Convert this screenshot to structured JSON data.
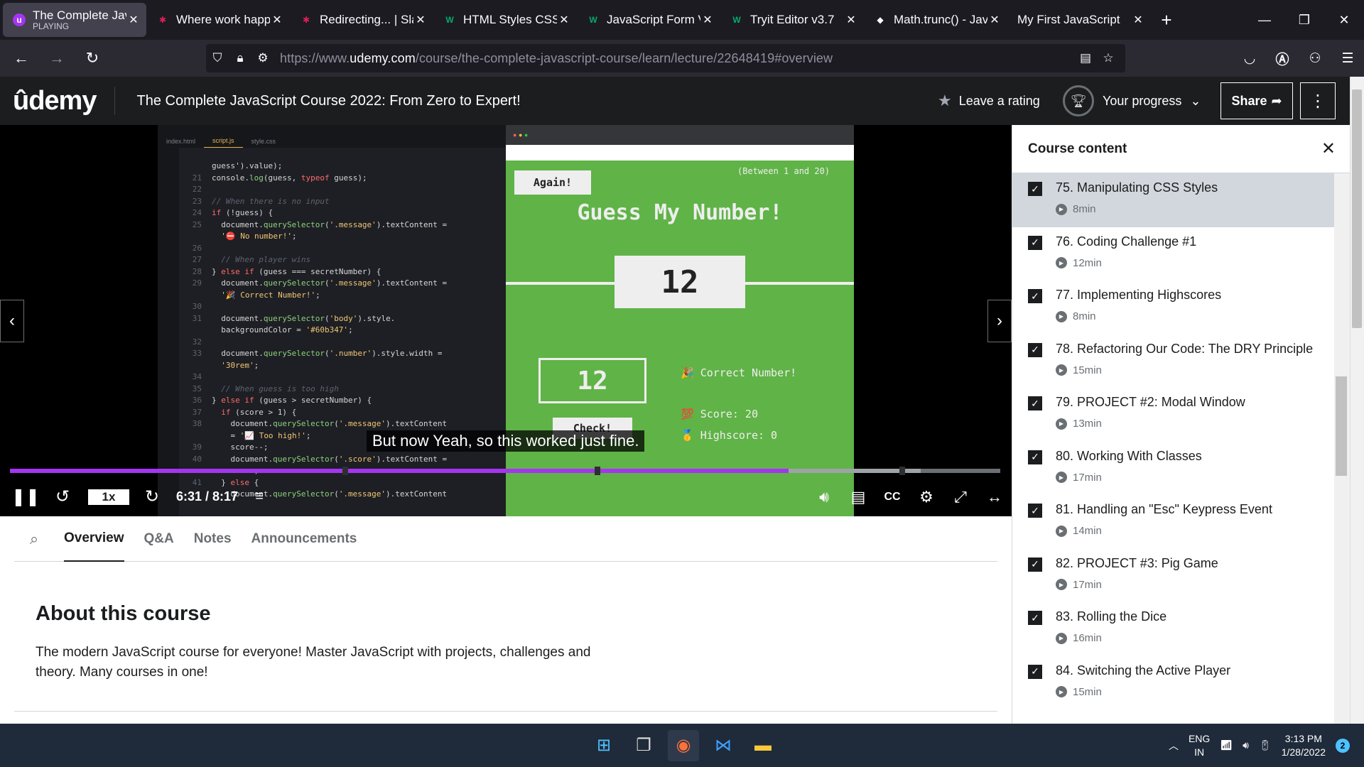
{
  "browser": {
    "tabs": [
      {
        "title": "The Complete Java",
        "subtitle": "PLAYING",
        "favicon_color": "#a435f0",
        "active": true
      },
      {
        "title": "Where work happe",
        "favicon_color": "#e01e5a"
      },
      {
        "title": "Redirecting... | Slac",
        "favicon_color": "#e01e5a"
      },
      {
        "title": "HTML Styles CSS",
        "favicon_color": "#04aa6d"
      },
      {
        "title": "JavaScript Form Va",
        "favicon_color": "#04aa6d"
      },
      {
        "title": "Tryit Editor v3.7",
        "favicon_color": "#04aa6d"
      },
      {
        "title": "Math.trunc() - Java",
        "favicon_color": "#ffffff"
      },
      {
        "title": "My First JavaScript",
        "favicon_color": ""
      }
    ],
    "url_prefix": "https://www.",
    "url_domain": "udemy.com",
    "url_path": "/course/the-complete-javascript-course/learn/lecture/22648419#overview"
  },
  "header": {
    "logo": "ûdemy",
    "course_title": "The Complete JavaScript Course 2022: From Zero to Expert!",
    "rating_label": "Leave a rating",
    "progress_label": "Your progress",
    "share_label": "Share"
  },
  "video": {
    "subtitle": "But now Yeah, so this worked just fine.",
    "speed": "1x",
    "time": "6:31 / 8:17",
    "progress": 0.786,
    "buffered": 0.92,
    "editor_tabs": [
      "index.html",
      "script.js",
      "style.css"
    ],
    "game": {
      "again": "Again!",
      "between": "(Between 1 and 20)",
      "title": "Guess My Number!",
      "number": "12",
      "guess": "12",
      "check": "Check!",
      "message": "Correct Number!",
      "score": "Score: 20",
      "highscore": "Highscore: 0",
      "bg_color": "#60b347"
    }
  },
  "content_tabs": [
    "Overview",
    "Q&A",
    "Notes",
    "Announcements"
  ],
  "about": {
    "heading": "About this course",
    "text": "The modern JavaScript course for everyone! Master JavaScript with projects, challenges and theory. Many courses in one!"
  },
  "sidebar": {
    "title": "Course content",
    "lectures": [
      {
        "title": "75. Manipulating CSS Styles",
        "duration": "8min",
        "active": true
      },
      {
        "title": "76. Coding Challenge #1",
        "duration": "12min"
      },
      {
        "title": "77. Implementing Highscores",
        "duration": "8min"
      },
      {
        "title": "78. Refactoring Our Code: The DRY Principle",
        "duration": "15min"
      },
      {
        "title": "79. PROJECT #2: Modal Window",
        "duration": "13min"
      },
      {
        "title": "80. Working With Classes",
        "duration": "17min"
      },
      {
        "title": "81. Handling an \"Esc\" Keypress Event",
        "duration": "14min"
      },
      {
        "title": "82. PROJECT #3: Pig Game",
        "duration": "17min"
      },
      {
        "title": "83. Rolling the Dice",
        "duration": "16min"
      },
      {
        "title": "84. Switching the Active Player",
        "duration": "15min"
      }
    ]
  },
  "taskbar": {
    "lang1": "ENG",
    "lang2": "IN",
    "time": "3:13 PM",
    "date": "1/28/2022",
    "notifications": "2"
  }
}
